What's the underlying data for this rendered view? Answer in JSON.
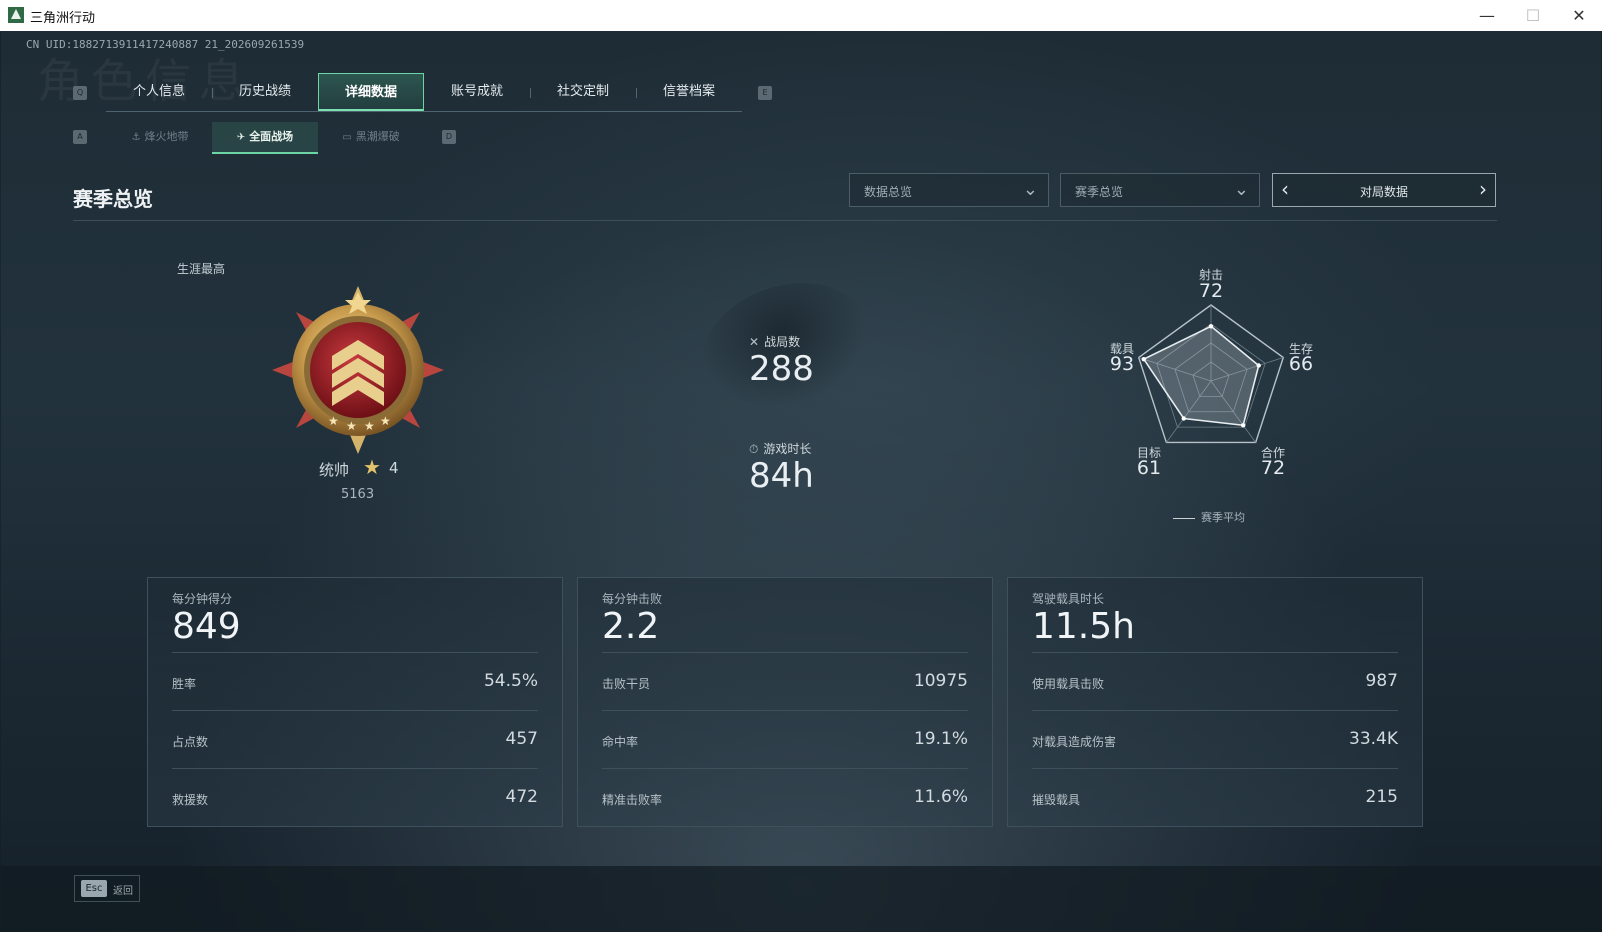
{
  "window": {
    "title": "三角洲行动",
    "minimize": "—",
    "maximize": "☐",
    "close": "✕"
  },
  "uid": "CN UID:1882713911417240887 21_202609261539",
  "watermark": "角色信息",
  "tabs": {
    "left_key": "Q",
    "right_key": "E",
    "items": [
      {
        "label": "个人信息"
      },
      {
        "label": "历史战绩"
      },
      {
        "label": "详细数据",
        "active": true
      },
      {
        "label": "账号成就"
      },
      {
        "label": "社交定制"
      },
      {
        "label": "信誉档案"
      }
    ]
  },
  "subtabs": {
    "left_key": "A",
    "right_key": "D",
    "items": [
      {
        "label": "烽火地带",
        "icon": "flame-zone-icon"
      },
      {
        "label": "全面战场",
        "icon": "battlefield-icon",
        "active": true
      },
      {
        "label": "黑潮爆破",
        "icon": "demolition-icon"
      }
    ]
  },
  "section": {
    "title": "赛季总览"
  },
  "filters": {
    "dropdown1": "数据总览",
    "dropdown2": "赛季总览",
    "pager_label": "对局数据"
  },
  "rank": {
    "career_label": "生涯最高",
    "name": "统帅",
    "stars": "4",
    "score": "5163"
  },
  "center_stats": {
    "matches_label": "战局数",
    "matches_value": "288",
    "playtime_label": "游戏时长",
    "playtime_value": "84h"
  },
  "radar": {
    "axes": [
      {
        "label": "射击",
        "value": "72"
      },
      {
        "label": "生存",
        "value": "66"
      },
      {
        "label": "合作",
        "value": "72"
      },
      {
        "label": "目标",
        "value": "61"
      },
      {
        "label": "载具",
        "value": "93"
      }
    ],
    "legend": "赛季平均"
  },
  "panels": [
    {
      "head_label": "每分钟得分",
      "head_value": "849",
      "rows": [
        {
          "label": "胜率",
          "value": "54.5%"
        },
        {
          "label": "占点数",
          "value": "457"
        },
        {
          "label": "救援数",
          "value": "472"
        }
      ]
    },
    {
      "head_label": "每分钟击败",
      "head_value": "2.2",
      "rows": [
        {
          "label": "击败干员",
          "value": "10975"
        },
        {
          "label": "命中率",
          "value": "19.1%"
        },
        {
          "label": "精准击败率",
          "value": "11.6%"
        }
      ]
    },
    {
      "head_label": "驾驶载具时长",
      "head_value": "11.5h",
      "rows": [
        {
          "label": "使用载具击败",
          "value": "987"
        },
        {
          "label": "对载具造成伤害",
          "value": "33.4K"
        },
        {
          "label": "摧毁载具",
          "value": "215"
        }
      ]
    }
  ],
  "footer": {
    "esc_key": "Esc",
    "back_label": "返回"
  },
  "colors": {
    "accent": "#6fd4a5",
    "gold": "#e4c46a",
    "medal_red": "#9c1a22"
  }
}
